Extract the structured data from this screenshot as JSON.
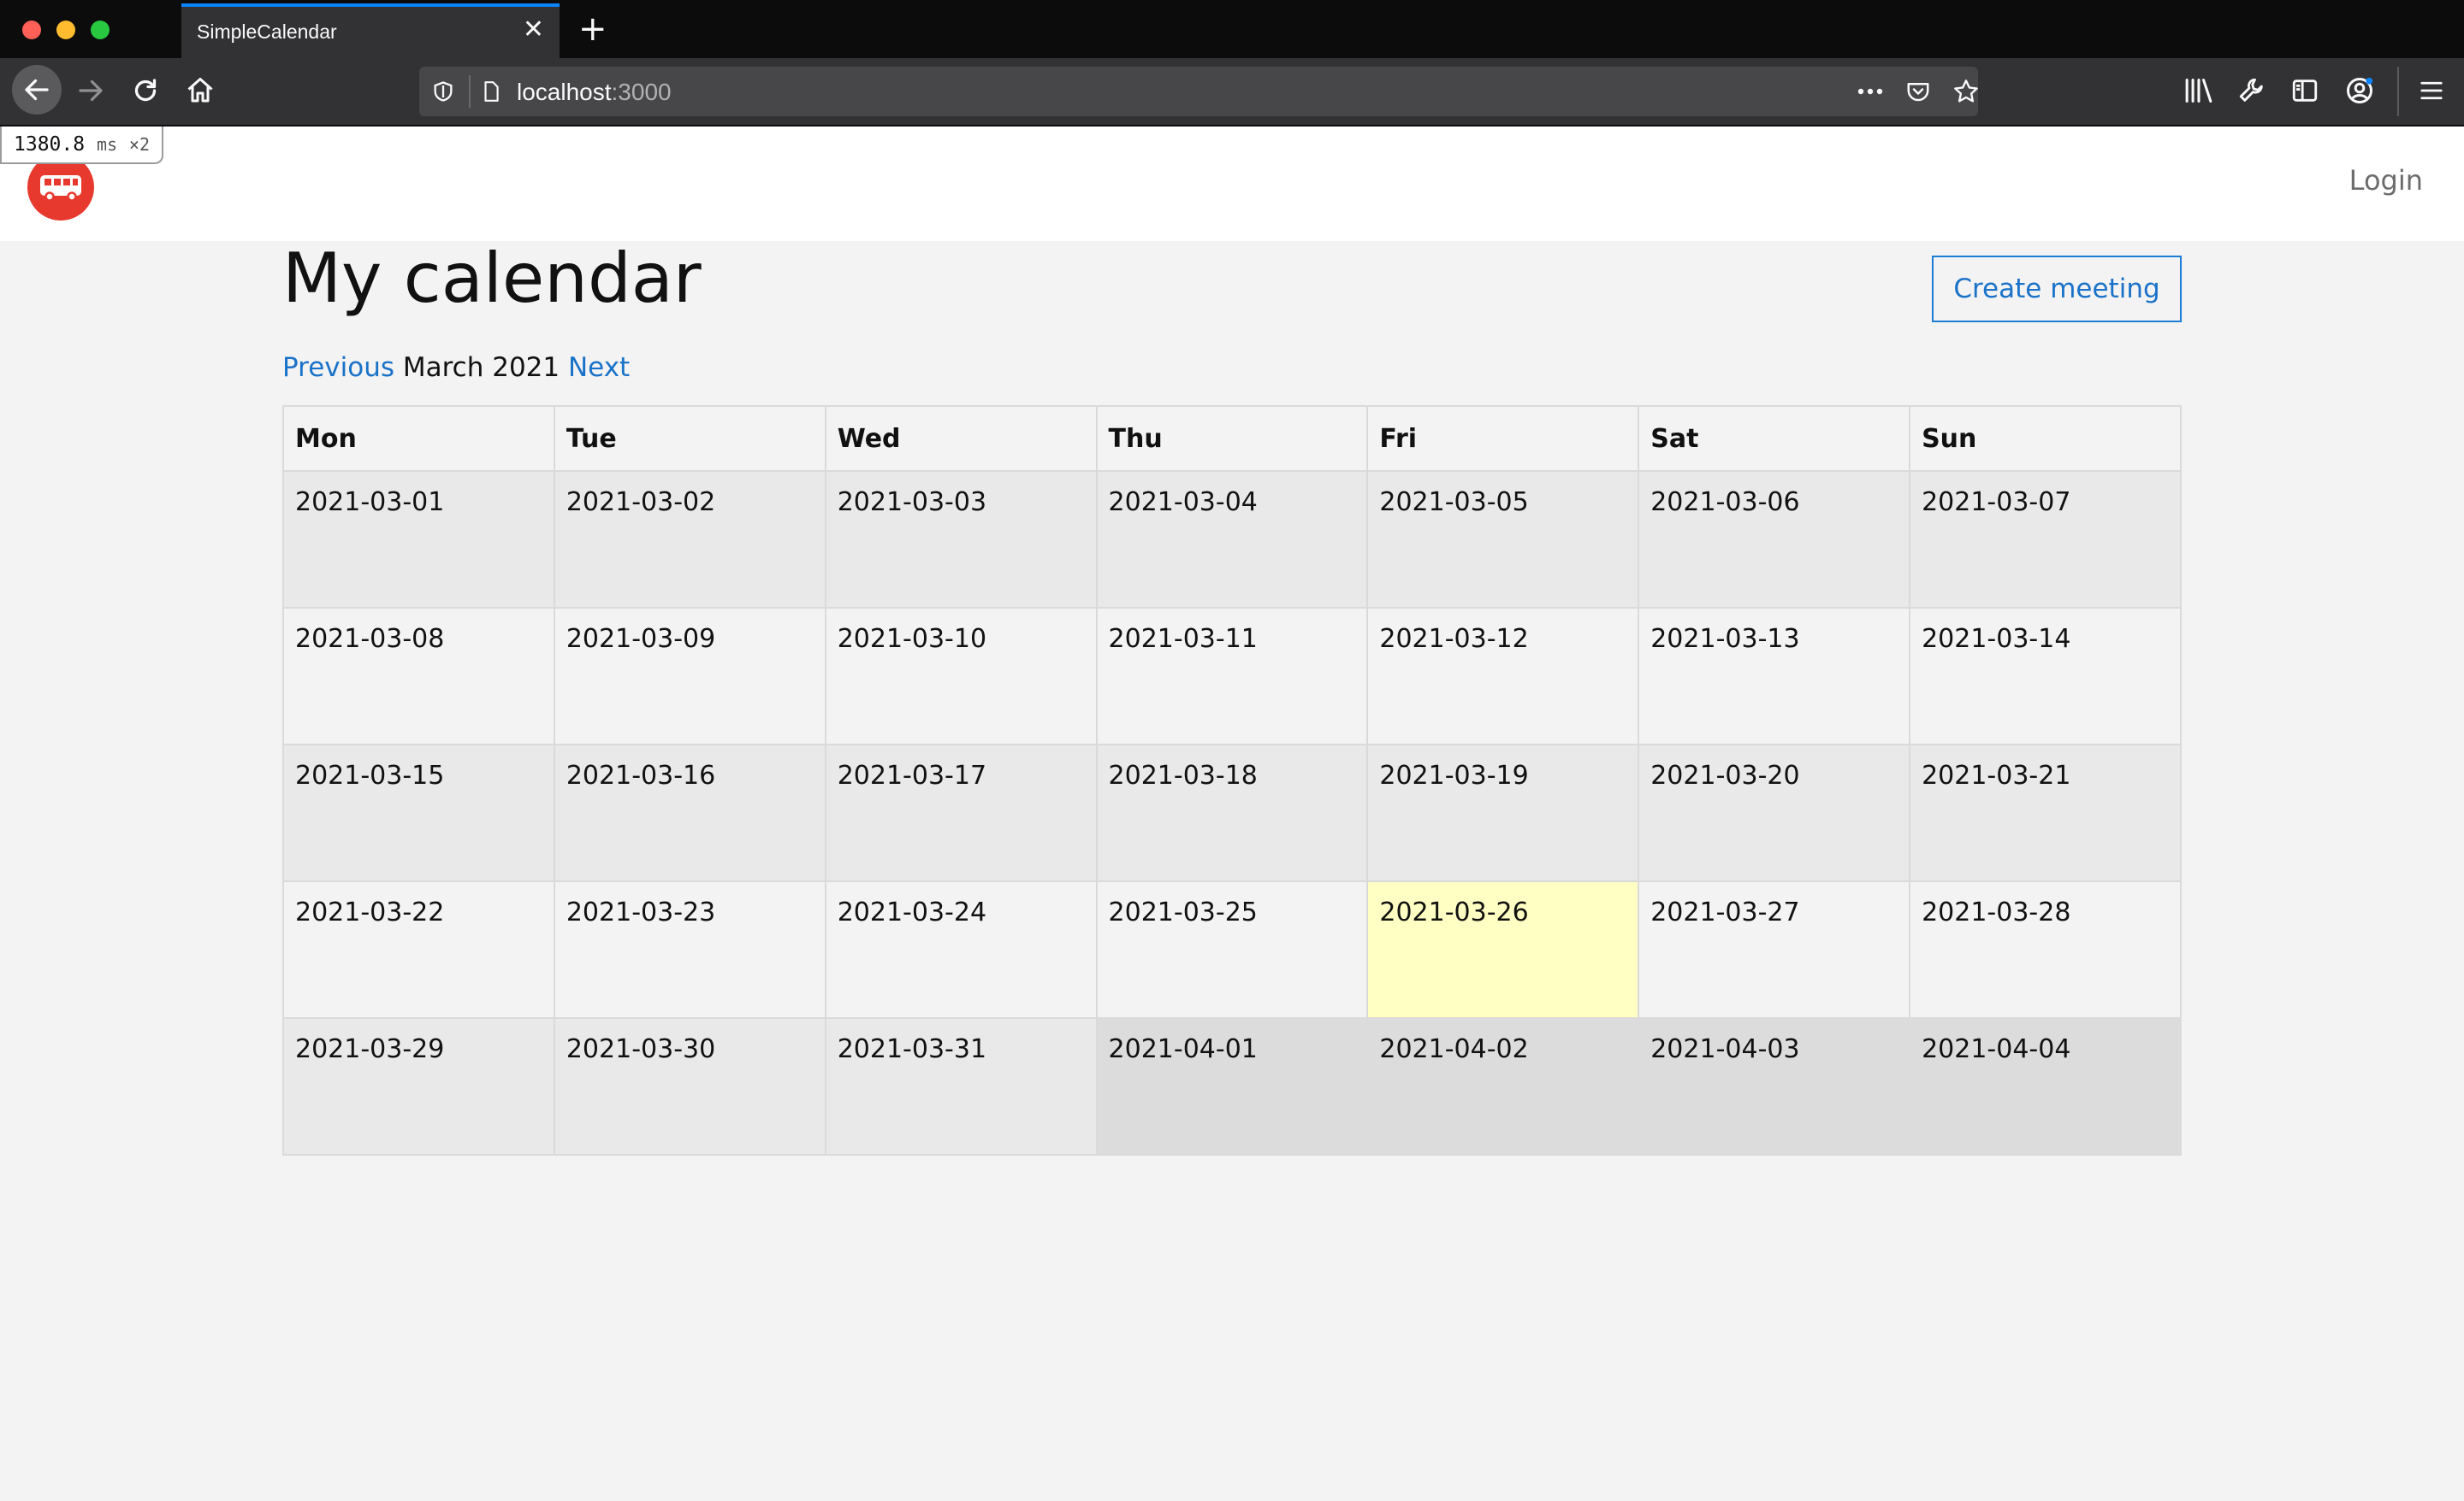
{
  "browser": {
    "tab_title": "SimpleCalendar",
    "url_host": "localhost",
    "url_port": ":3000"
  },
  "perf": {
    "value": "1380.8",
    "unit": "ms",
    "multiplier": "×2"
  },
  "header": {
    "login_label": "Login"
  },
  "page": {
    "title": "My calendar",
    "create_button": "Create meeting",
    "prev_label": "Previous",
    "month_label": "March 2021",
    "next_label": "Next"
  },
  "calendar": {
    "weekdays": [
      "Mon",
      "Tue",
      "Wed",
      "Thu",
      "Fri",
      "Sat",
      "Sun"
    ],
    "weeks": [
      [
        "2021-03-01",
        "2021-03-02",
        "2021-03-03",
        "2021-03-04",
        "2021-03-05",
        "2021-03-06",
        "2021-03-07"
      ],
      [
        "2021-03-08",
        "2021-03-09",
        "2021-03-10",
        "2021-03-11",
        "2021-03-12",
        "2021-03-13",
        "2021-03-14"
      ],
      [
        "2021-03-15",
        "2021-03-16",
        "2021-03-17",
        "2021-03-18",
        "2021-03-19",
        "2021-03-20",
        "2021-03-21"
      ],
      [
        "2021-03-22",
        "2021-03-23",
        "2021-03-24",
        "2021-03-25",
        "2021-03-26",
        "2021-03-27",
        "2021-03-28"
      ],
      [
        "2021-03-29",
        "2021-03-30",
        "2021-03-31",
        "2021-04-01",
        "2021-04-02",
        "2021-04-03",
        "2021-04-04"
      ]
    ],
    "today": "2021-03-26",
    "today_color": "#ffffc3",
    "accent_color": "#1a73c8"
  }
}
